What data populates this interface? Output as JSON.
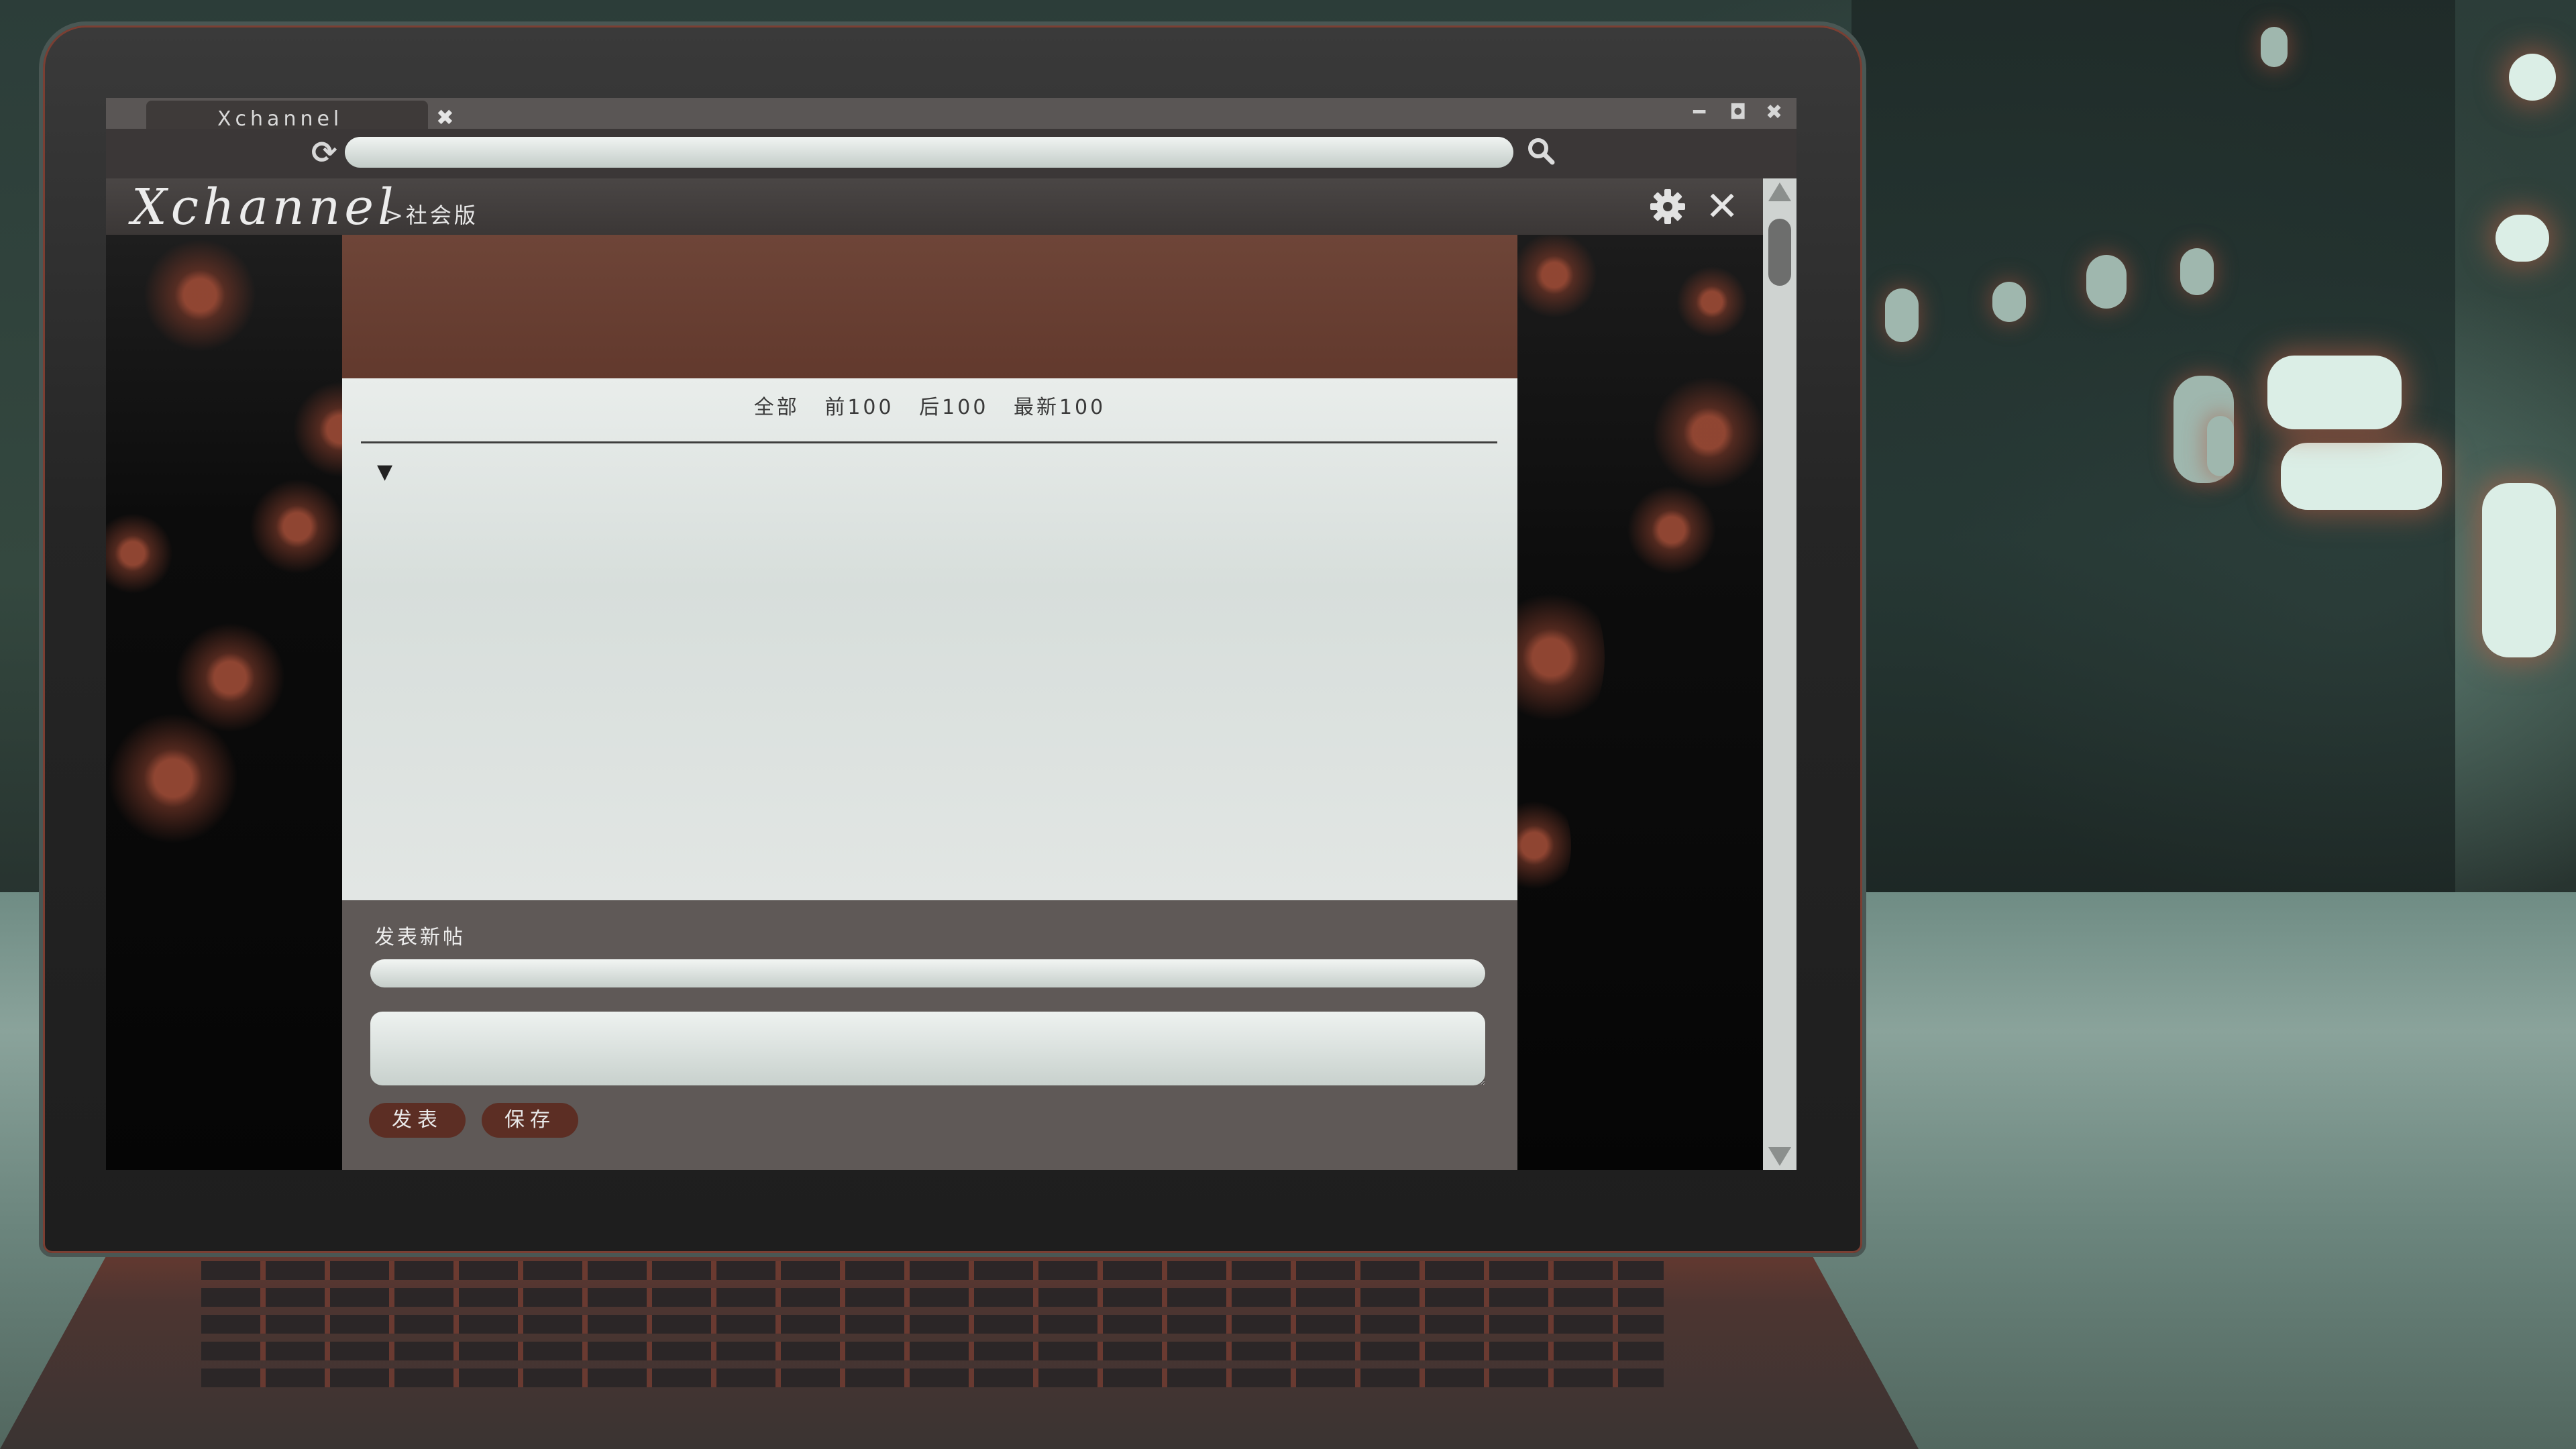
{
  "browser": {
    "tab_title": "Xchannel",
    "tab_close": "✖",
    "window_controls": {
      "minimize": "━",
      "maximize": "◘",
      "close": "✖"
    },
    "reload_icon": "⟳",
    "address_value": "",
    "icons": [
      "reload-icon",
      "search-icon",
      "close-icon",
      "minimize-icon",
      "maximize-icon"
    ]
  },
  "app": {
    "logo": "Xchannel",
    "board_breadcrumb": ">社会版",
    "settings_icon": "gear-icon",
    "close_glyph": "✕"
  },
  "thread": {
    "filters": [
      "全部",
      "前100",
      "后100",
      "最新100"
    ],
    "expand_toggle": "▼"
  },
  "compose": {
    "title": "发表新帖",
    "title_value": "",
    "body_value": "",
    "post_label": "发表",
    "save_label": "保存"
  },
  "colors": {
    "banner": "#6e4538",
    "accent_button": "#5c2e24",
    "compose_bg": "#5f5957",
    "content_bg": "#e2e6e4"
  }
}
